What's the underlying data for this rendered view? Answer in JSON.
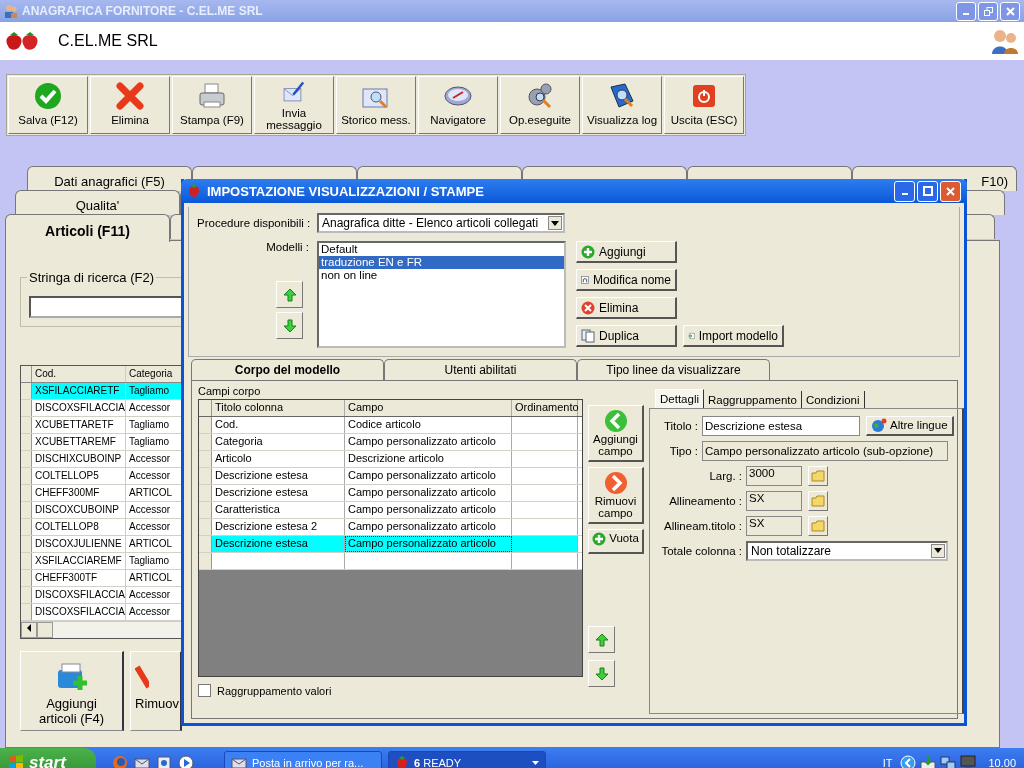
{
  "window": {
    "title": "ANAGRAFICA FORNITORE - C.EL.ME SRL"
  },
  "header": {
    "company": "C.EL.ME SRL"
  },
  "toolbar": [
    {
      "label": "Salva (F12)",
      "kind": "check"
    },
    {
      "label": "Elimina",
      "kind": "delete"
    },
    {
      "label": "Stampa (F9)",
      "kind": "print"
    },
    {
      "label": "Invia messaggio",
      "kind": "message"
    },
    {
      "label": "Storico mess.",
      "kind": "history"
    },
    {
      "label": "Navigatore",
      "kind": "navigator"
    },
    {
      "label": "Op.eseguite",
      "kind": "ops"
    },
    {
      "label": "Visualizza log",
      "kind": "log"
    },
    {
      "label": "Uscita (ESC)",
      "kind": "exit"
    }
  ],
  "main_tabs": [
    [
      {
        "label": "Dati anagrafici (F5)",
        "selected": false
      },
      {
        "label": "F10)",
        "selected": false
      }
    ],
    [
      {
        "label": "Qualita'",
        "selected": false
      }
    ],
    [
      {
        "label": "Articoli (F11)",
        "selected": true
      }
    ]
  ],
  "search": {
    "label": "Stringa di ricerca (F2)"
  },
  "articles_table": {
    "columns": [
      "Cod.",
      "Categoria"
    ],
    "rows": [
      {
        "cells": [
          "XSFILACCIARETF",
          "Tagliamo"
        ],
        "selected": true
      },
      {
        "cells": [
          "DISCOXSFILACCIA",
          "Accessor"
        ],
        "selected": false
      },
      {
        "cells": [
          "XCUBETTARETF",
          "Tagliamo"
        ],
        "selected": false
      },
      {
        "cells": [
          "XCUBETTAREMF",
          "Tagliamo"
        ],
        "selected": false
      },
      {
        "cells": [
          "DISCHIXCUBOINP",
          "Accessor"
        ],
        "selected": false
      },
      {
        "cells": [
          "COLTELLOP5",
          "Accessor"
        ],
        "selected": false
      },
      {
        "cells": [
          "CHEFF300MF",
          "ARTICOL"
        ],
        "selected": false
      },
      {
        "cells": [
          "DISCOXCUBOINP",
          "Accessor"
        ],
        "selected": false
      },
      {
        "cells": [
          "COLTELLOP8",
          "Accessor"
        ],
        "selected": false
      },
      {
        "cells": [
          "DISCOXJULIENNE",
          "ARTICOL"
        ],
        "selected": false
      },
      {
        "cells": [
          "XSFILACCIAREMF",
          "Tagliamo"
        ],
        "selected": false
      },
      {
        "cells": [
          "CHEFF300TF",
          "ARTICOL"
        ],
        "selected": false
      },
      {
        "cells": [
          "DISCOXSFILACCIA",
          "Accessor"
        ],
        "selected": false
      },
      {
        "cells": [
          "DISCOXSFILACCIA",
          "Accessor"
        ],
        "selected": false
      }
    ]
  },
  "article_buttons": [
    {
      "label": "Aggiungi articoli (F4)",
      "kind": "add-items"
    },
    {
      "label": "Rimuov",
      "kind": "remove"
    }
  ],
  "dialog": {
    "title": "IMPOSTAZIONE VISUALIZZAZIONI / STAMPE",
    "procedure": {
      "label": "Procedure disponibili :",
      "value": "Anagrafica ditte - Elenco articoli collegati"
    },
    "models": {
      "label": "Modelli :",
      "items": [
        {
          "label": "Default",
          "selected": false
        },
        {
          "label": "traduzione EN e FR",
          "selected": true
        },
        {
          "label": "non on line",
          "selected": false
        }
      ]
    },
    "model_buttons": [
      {
        "label": "Aggiungi",
        "kind": "add"
      },
      {
        "label": "Modifica nome",
        "kind": "rename"
      },
      {
        "label": "Elimina",
        "kind": "delete"
      },
      {
        "label": "Duplica",
        "kind": "duplicate"
      },
      {
        "label": "Import modello",
        "kind": "import"
      }
    ],
    "tabs": [
      {
        "label": "Corpo del modello",
        "selected": true
      },
      {
        "label": "Utenti abilitati",
        "selected": false
      },
      {
        "label": "Tipo linee da visualizzare",
        "selected": false
      }
    ],
    "fields": {
      "title": "Campi corpo",
      "columns": [
        "Titolo colonna",
        "Campo",
        "Ordinamento"
      ],
      "rows": [
        {
          "cells": [
            "Cod.",
            "Codice articolo"
          ],
          "selected": false
        },
        {
          "cells": [
            "Categoria",
            "Campo personalizzato articolo"
          ],
          "selected": false
        },
        {
          "cells": [
            "Articolo",
            "Descrizione articolo"
          ],
          "selected": false
        },
        {
          "cells": [
            "Descrizione estesa",
            "Campo personalizzato articolo"
          ],
          "selected": false
        },
        {
          "cells": [
            "Descrizione estesa",
            "Campo personalizzato articolo"
          ],
          "selected": false
        },
        {
          "cells": [
            "Caratteristica",
            "Campo personalizzato articolo"
          ],
          "selected": false
        },
        {
          "cells": [
            "Descrizione estesa 2",
            "Campo personalizzato articolo"
          ],
          "selected": false
        },
        {
          "cells": [
            "Descrizione estesa",
            "Campo personalizzato articolo"
          ],
          "selected": true
        }
      ]
    },
    "field_buttons": [
      {
        "label": "Aggiungi campo",
        "kind": "add-left"
      },
      {
        "label": "Rimuovi campo",
        "kind": "remove-right"
      },
      {
        "label": "Vuota",
        "kind": "clear"
      }
    ],
    "grouping": {
      "label": "Raggruppamento valori",
      "checked": false
    },
    "detail_tabs": [
      {
        "label": "Dettagli",
        "selected": true
      },
      {
        "label": "Raggruppamento",
        "selected": false
      },
      {
        "label": "Condizioni",
        "selected": false
      }
    ],
    "details": {
      "title": {
        "label": "Titolo :",
        "value": "Descrizione estesa"
      },
      "languages_button": "Altre lingue",
      "type": {
        "label": "Tipo :",
        "value": "Campo personalizzato articolo (sub-opzione)"
      },
      "options": [
        {
          "label": "Larg. :",
          "value": "3000"
        },
        {
          "label": "Allineamento :",
          "value": "SX"
        },
        {
          "label": "Allineam.titolo :",
          "value": "SX"
        }
      ],
      "total": {
        "label": "Totale colonna :",
        "value": "Non totalizzare"
      }
    }
  },
  "taskbar": {
    "start": "start",
    "tasks": [
      {
        "label": "Posta in arrivo per ra...",
        "selected": false
      },
      {
        "label": "**6** READY",
        "selected": true
      }
    ],
    "language": "IT",
    "clock": "10.00"
  }
}
